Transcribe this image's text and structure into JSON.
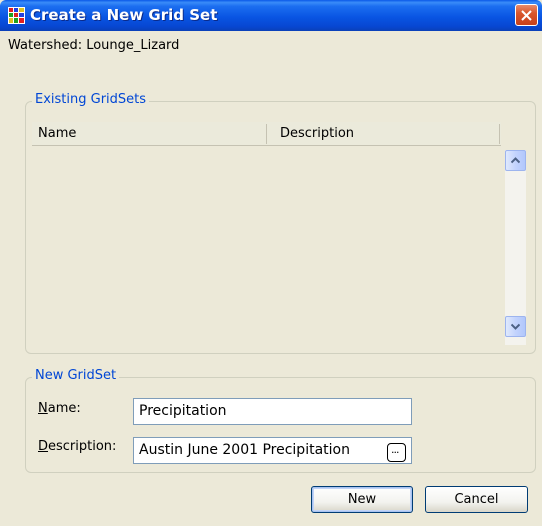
{
  "window": {
    "title": "Create a New Grid Set"
  },
  "watershed_label": "Watershed: Lounge_Lizard",
  "existing": {
    "legend": "Existing GridSets",
    "columns": [
      "Name",
      "Description"
    ],
    "rows": []
  },
  "new_gridset": {
    "legend": "New GridSet",
    "name_label_key": "N",
    "name_label_rest": "ame:",
    "name_value": "Precipitation",
    "description_label_key": "D",
    "description_label_rest": "escription:",
    "description_value": "Austin June 2001 Precipitation",
    "browse_label": "..."
  },
  "buttons": {
    "new": "New",
    "cancel": "Cancel"
  },
  "colors": {
    "titlebar": "#0955e3",
    "legend_text": "#0046d5",
    "close_button": "#d9572d"
  },
  "icons": {
    "app": "grid-app-icon",
    "close": "close-icon",
    "scroll_up": "chevron-up-icon",
    "scroll_down": "chevron-down-icon"
  }
}
